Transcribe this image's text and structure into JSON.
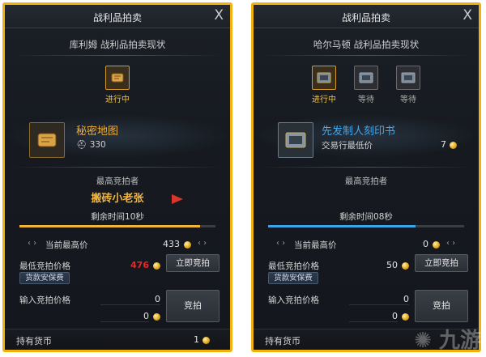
{
  "left": {
    "title": "战利品拍卖",
    "close": "X",
    "subtitle": "库利姆 战利品拍卖现状",
    "slots": [
      {
        "label": "进行中",
        "state": "active"
      }
    ],
    "item_name": "秘密地图",
    "item_meta": "330",
    "item_name_color": "#f1ad34",
    "top_bidder_label": "最高竞拍者",
    "top_bidder": "搬砖小老张",
    "timer": "剩余时间10秒",
    "progress": 0.92,
    "bar_color": "#efb53a",
    "current_price_label": "当前最高价",
    "current_price": "433",
    "min_bid_label": "最低竞拍价格",
    "min_bid": "476",
    "buyout_button": "立即竞拍",
    "insurance_button": "货款安保费",
    "input_label": "输入竞拍价格",
    "input_value_1": "0",
    "input_value_2": "0",
    "bid_button": "竞拍",
    "currency_label": "持有货币",
    "currency_value": "1"
  },
  "right": {
    "title": "战利品拍卖",
    "close": "X",
    "subtitle": "哈尔马顿 战利品拍卖现状",
    "slots": [
      {
        "label": "进行中",
        "state": "active"
      },
      {
        "label": "等待",
        "state": "waiting"
      },
      {
        "label": "等待",
        "state": "waiting"
      }
    ],
    "item_name": "先发制人刻印书",
    "item_meta": "交易行最低价",
    "item_meta_value": "7",
    "item_name_color": "#3fa9f0",
    "top_bidder_label": "最高竞拍者",
    "top_bidder": "",
    "timer": "剩余时间08秒",
    "progress": 0.75,
    "bar_color": "#3aa6e6",
    "current_price_label": "当前最高价",
    "current_price": "0",
    "min_bid_label": "最低竞拍价格",
    "min_bid": "50",
    "buyout_button": "立即竞拍",
    "insurance_button": "货款安保费",
    "input_label": "输入竞拍价格",
    "input_value_1": "0",
    "input_value_2": "0",
    "bid_button": "竞拍",
    "currency_label": "持有货币",
    "currency_value": ""
  },
  "watermark": "九游"
}
